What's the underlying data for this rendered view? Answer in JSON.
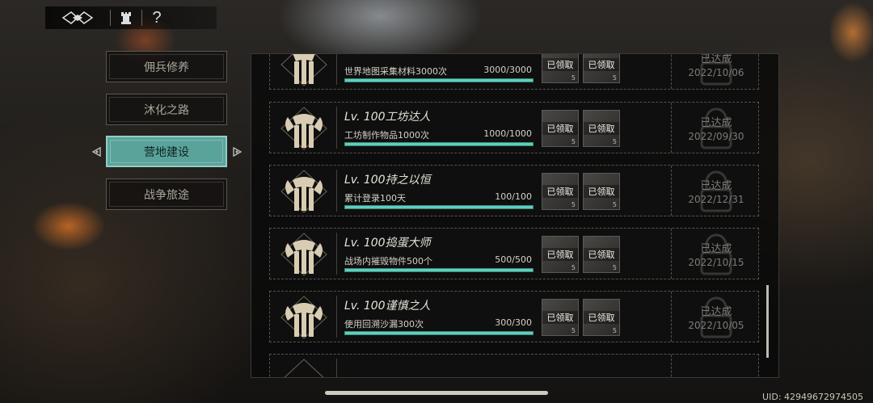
{
  "toolbar": {
    "help_label": "?"
  },
  "side_menu": [
    {
      "label": "佣兵修养",
      "active": false
    },
    {
      "label": "沐化之路",
      "active": false
    },
    {
      "label": "营地建设",
      "active": true
    },
    {
      "label": "战争旅途",
      "active": false
    }
  ],
  "achievements": [
    {
      "title": "",
      "desc": "世界地图采集材料3000次",
      "progress": "3000/3000",
      "fill": 1.0,
      "rewards": [
        {
          "label": "已领取",
          "qty": "5"
        },
        {
          "label": "已领取",
          "qty": "5"
        }
      ],
      "status": "已达成",
      "date": "2022/10/06"
    },
    {
      "title": "Lv. 100工坊达人",
      "desc": "工坊制作物品1000次",
      "progress": "1000/1000",
      "fill": 1.0,
      "rewards": [
        {
          "label": "已领取",
          "qty": "5"
        },
        {
          "label": "已领取",
          "qty": "5"
        }
      ],
      "status": "已达成",
      "date": "2022/09/30"
    },
    {
      "title": "Lv. 100持之以恒",
      "desc": "累计登录100天",
      "progress": "100/100",
      "fill": 1.0,
      "rewards": [
        {
          "label": "已领取",
          "qty": "5"
        },
        {
          "label": "已领取",
          "qty": "5"
        }
      ],
      "status": "已达成",
      "date": "2022/12/31"
    },
    {
      "title": "Lv. 100捣蛋大师",
      "desc": "战场内摧毁物件500个",
      "progress": "500/500",
      "fill": 1.0,
      "rewards": [
        {
          "label": "已领取",
          "qty": "5"
        },
        {
          "label": "已领取",
          "qty": "5"
        }
      ],
      "status": "已达成",
      "date": "2022/10/15"
    },
    {
      "title": "Lv. 100谨慎之人",
      "desc": "使用回溯沙漏300次",
      "progress": "300/300",
      "fill": 1.0,
      "rewards": [
        {
          "label": "已领取",
          "qty": "5"
        },
        {
          "label": "已领取",
          "qty": "5"
        }
      ],
      "status": "已达成",
      "date": "2022/10/05"
    }
  ],
  "footer": {
    "uid": "UID: 42949672974505"
  },
  "colors": {
    "accent": "#5aa39a",
    "progress": "#5ad0c8"
  },
  "icons": [
    "game-logo-icon",
    "tower-icon",
    "left-arrow-icon",
    "right-arrow-icon",
    "axe-emblem-icon",
    "lock-stamp-icon"
  ]
}
